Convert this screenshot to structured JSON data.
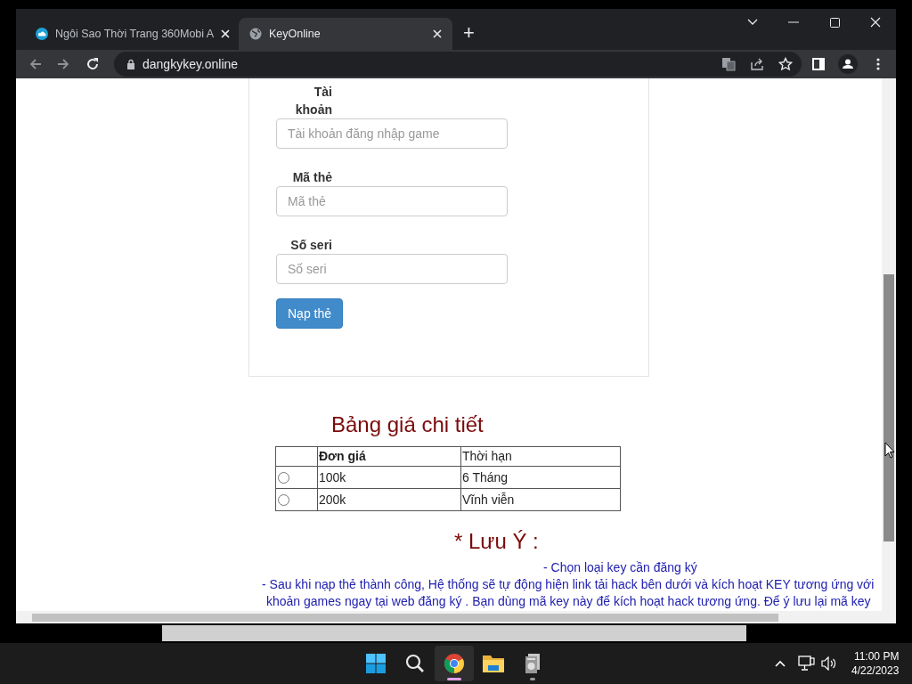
{
  "browser": {
    "tabs": [
      {
        "title": "Ngôi Sao Thời Trang 360Mobi A",
        "selected": false
      },
      {
        "title": "KeyOnline",
        "selected": true
      }
    ],
    "new_tab": "+",
    "address": "dangkykey.online"
  },
  "form": {
    "fields": [
      {
        "label": "Tài khoản",
        "placeholder": "Tài khoản đăng nhập game"
      },
      {
        "label": "Mã thẻ",
        "placeholder": "Mã thẻ"
      },
      {
        "label": "Số seri",
        "placeholder": "Số seri"
      }
    ],
    "submit": "Nạp thẻ"
  },
  "price_table": {
    "title": "Bảng giá chi tiết",
    "columns": [
      "Đơn giá",
      "Thời hạn"
    ],
    "rows": [
      {
        "selected": false,
        "cells": [
          "100k",
          "6 Tháng"
        ]
      },
      {
        "selected": false,
        "cells": [
          "200k",
          "Vĩnh viễn"
        ]
      }
    ]
  },
  "note": {
    "title": "* Lưu Ý :",
    "lines": [
      "- Chọn loại key cần đăng ký",
      "- Sau khi nạp thẻ thành công, Hệ thống sẽ tự động hiện link tải hack bên dưới và kích hoạt KEY tương ứng với",
      "khoản games ngay tại web đăng ký . Bạn dùng mã key này để kích hoạt hack tương ứng. Để ý lưu lại mã key"
    ]
  },
  "taskbar": {
    "apps": [
      {
        "kind": "chrome",
        "selected": true,
        "running": true
      },
      {
        "kind": "folder",
        "selected": false,
        "running": false
      },
      {
        "kind": "app",
        "selected": false,
        "running": true
      }
    ],
    "time": "11:00 PM",
    "date": "4/22/2023"
  }
}
